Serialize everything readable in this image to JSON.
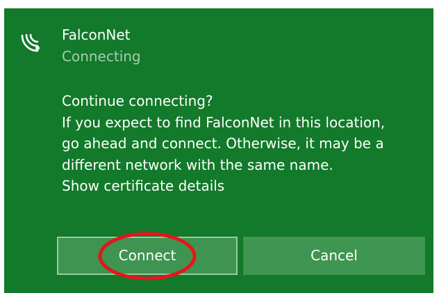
{
  "network": {
    "name": "FalconNet",
    "status": "Connecting",
    "icon": "wifi-icon"
  },
  "message": {
    "question": "Continue connecting?",
    "lines": [
      "If you expect to find FalconNet in this location,",
      "go ahead and connect. Otherwise, it may be a",
      "different network with the same name."
    ],
    "cert_link": "Show certificate details"
  },
  "buttons": {
    "connect_label": "Connect",
    "cancel_label": "Cancel"
  },
  "colors": {
    "panel_background": "#127a2a",
    "button_background": "#3e9450",
    "secondary_text": "#a8ccb0",
    "annotation_ring": "#e8141b"
  }
}
